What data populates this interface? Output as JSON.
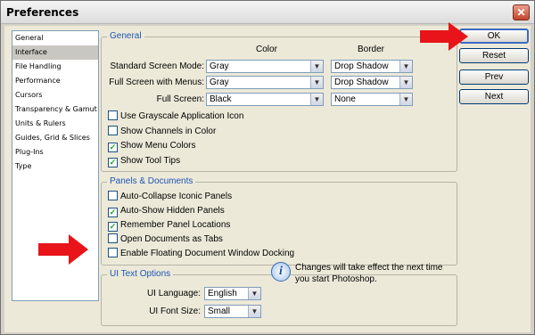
{
  "window": {
    "title": "Preferences",
    "close_glyph": "✕"
  },
  "categories": [
    "General",
    "Interface",
    "File Handling",
    "Performance",
    "Cursors",
    "Transparency & Gamut",
    "Units & Rulers",
    "Guides, Grid & Slices",
    "Plug-Ins",
    "Type"
  ],
  "selected_category": "Interface",
  "general": {
    "title": "General",
    "col_color": "Color",
    "col_border": "Border",
    "rows": [
      {
        "label": "Standard Screen Mode:",
        "color": "Gray",
        "border": "Drop Shadow"
      },
      {
        "label": "Full Screen with Menus:",
        "color": "Gray",
        "border": "Drop Shadow"
      },
      {
        "label": "Full Screen:",
        "color": "Black",
        "border": "None"
      }
    ],
    "checkboxes": [
      {
        "label": "Use Grayscale Application Icon",
        "checked": false
      },
      {
        "label": "Show Channels in Color",
        "checked": false
      },
      {
        "label": "Show Menu Colors",
        "checked": true
      },
      {
        "label": "Show Tool Tips",
        "checked": true
      }
    ]
  },
  "panels": {
    "title": "Panels & Documents",
    "checkboxes": [
      {
        "label": "Auto-Collapse Iconic Panels",
        "checked": false
      },
      {
        "label": "Auto-Show Hidden Panels",
        "checked": true
      },
      {
        "label": "Remember Panel Locations",
        "checked": true
      },
      {
        "label": "Open Documents as Tabs",
        "checked": false
      },
      {
        "label": "Enable Floating Document Window Docking",
        "checked": false
      }
    ]
  },
  "ui_text": {
    "title": "UI Text Options",
    "language_label": "UI Language:",
    "language_value": "English",
    "font_size_label": "UI Font Size:",
    "font_size_value": "Small",
    "info_glyph": "i",
    "note": "Changes will take effect the next time you start Photoshop."
  },
  "buttons": {
    "ok": "OK",
    "reset": "Reset",
    "prev": "Prev",
    "next": "Next"
  },
  "colors": {
    "highlight_arrow": "#e8141a",
    "group_title": "#1f55b6"
  },
  "icons": {
    "arrow": "red-arrow-icon",
    "info": "info-icon",
    "close": "close-icon",
    "dropdown": "chevron-down-icon"
  }
}
